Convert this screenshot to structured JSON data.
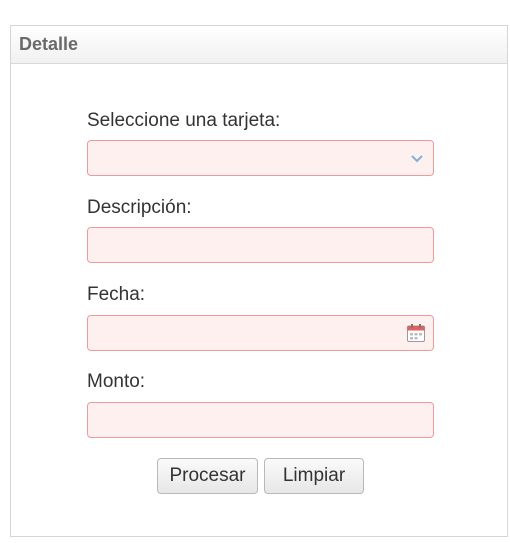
{
  "panel": {
    "title": "Detalle"
  },
  "form": {
    "card_label": "Seleccione una tarjeta:",
    "card_value": "",
    "description_label": "Descripción:",
    "description_value": "",
    "date_label": "Fecha:",
    "date_value": "",
    "amount_label": "Monto:",
    "amount_value": ""
  },
  "buttons": {
    "process_label": "Procesar",
    "clear_label": "Limpiar"
  },
  "icons": {
    "select_arrow": "chevron-down-icon",
    "date_picker": "calendar-icon"
  },
  "colors": {
    "invalid_border": "#ef9a9a",
    "invalid_background": "#fff0f0",
    "chevron": "#7fb3d5"
  }
}
